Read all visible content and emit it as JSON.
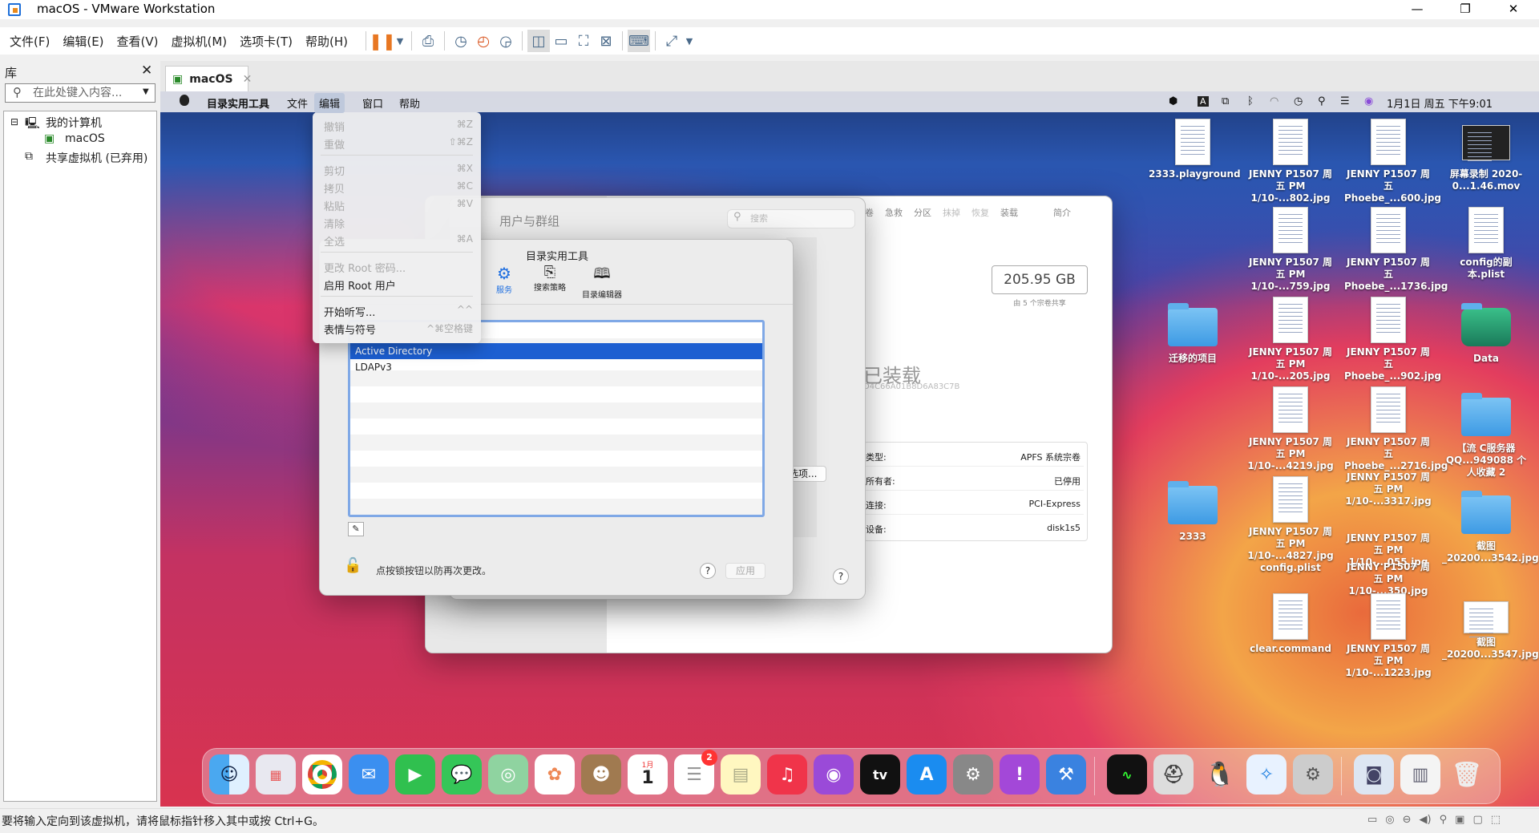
{
  "window": {
    "title": "macOS - VMware Workstation",
    "controls": [
      "—",
      "❐",
      "✕"
    ]
  },
  "menubar": {
    "items": [
      "文件(F)",
      "编辑(E)",
      "查看(V)",
      "虚拟机(M)",
      "选项卡(T)",
      "帮助(H)"
    ]
  },
  "library": {
    "title": "库",
    "close": "✕",
    "search_placeholder": "在此处键入内容...",
    "my_computer": "我的计算机",
    "vm_name": "macOS",
    "shared": "共享虚拟机 (已弃用)"
  },
  "tab": {
    "label": "macOS",
    "close": "✕"
  },
  "mac_menubar": {
    "apple": "",
    "app": "目录实用工具",
    "items": [
      "文件",
      "编辑",
      "窗口",
      "帮助"
    ],
    "clock": "1月1日 周五 下午9:01"
  },
  "edit_menu": {
    "items": [
      {
        "label": "撤销",
        "key": "⌘Z",
        "enabled": false
      },
      {
        "label": "重做",
        "key": "⇧⌘Z",
        "enabled": false
      },
      {
        "label": "剪切",
        "key": "⌘X",
        "enabled": false
      },
      {
        "label": "拷贝",
        "key": "⌘C",
        "enabled": false
      },
      {
        "label": "粘贴",
        "key": "⌘V",
        "enabled": false
      },
      {
        "label": "清除",
        "key": "",
        "enabled": false
      },
      {
        "label": "全选",
        "key": "⌘A",
        "enabled": false
      },
      {
        "label": "更改 Root 密码...",
        "key": "",
        "enabled": false
      },
      {
        "label": "启用 Root 用户",
        "key": "",
        "enabled": true
      },
      {
        "label": "开始听写...",
        "key": "^^",
        "enabled": true
      },
      {
        "label": "表情与符号",
        "key": "^⌘空格键",
        "enabled": true
      }
    ]
  },
  "users_groups": {
    "title": "用户与群组",
    "search_placeholder": "搜索",
    "option_button": "选项...",
    "help": "?"
  },
  "disk_utility": {
    "toolbar": [
      "卷",
      "急救",
      "分区",
      "抹掉",
      "恢复",
      "装载",
      "简介"
    ],
    "capacity": "205.95 GB",
    "capacity_note": "由 5 个宗卷共享",
    "mounted": "已装载",
    "uuid": "D4C66A01B8D6A83C7B",
    "rows": [
      {
        "k": "类型:",
        "v": "APFS 系统宗卷"
      },
      {
        "k": "所有者:",
        "v": "已停用"
      },
      {
        "k": "连接:",
        "v": "PCI-Express"
      },
      {
        "k": "设备:",
        "v": "disk1s5"
      }
    ]
  },
  "dir_utility": {
    "title": "目录实用工具",
    "tabs": [
      "服务",
      "搜索策略",
      "目录编辑器"
    ],
    "services": [
      "Active Directory",
      "LDAPv3"
    ],
    "edit_icon": "✎",
    "lock_text": "点按锁按钮以防再次更改。",
    "help": "?",
    "apply": "应用"
  },
  "desktop": {
    "icons": [
      "2333.playground",
      "JENNY P1507 周五 PM 1/10-...802.jpg",
      "JENNY P1507 周五 Phoebe_...600.jpg",
      "屏幕录制 2020-0...1.46.mov",
      "JENNY P1507 周五 PM 1/10-...759.jpg",
      "JENNY P1507 周五 Phoebe_...1736.jpg",
      "config的副本.plist",
      "迁移的项目",
      "JENNY P1507 周五 PM 1/10-...205.jpg",
      "JENNY P1507 周五 Phoebe_...902.jpg",
      "Data",
      "JENNY P1507 周五 PM 1/10-...4219.jpg",
      "JENNY P1507 周五 Phoebe_...2716.jpg",
      "JENNY P1507 周五 PM 1/10-...3317.jpg",
      "【流 C服务器 QQ...949088 个人收藏 2",
      "2333",
      "JENNY P1507 周五 PM 1/10-...4827.jpg",
      "config.plist",
      "JENNY P1507 周五 PM 1/10-...055.jpg",
      "JENNY P1507 周五 PM 1/10-...350.jpg",
      "截图 _20200...3542.jpg",
      "clear.command",
      "JENNY P1507 周五 PM 1/10-...1223.jpg",
      "截图 _20200...3547.jpg"
    ]
  },
  "dock": {
    "calendar_month": "1月",
    "calendar_day": "1",
    "reminders_badge": "2",
    "tv": "tv"
  },
  "status": {
    "message": "要将输入定向到该虚拟机，请将鼠标指针移入其中或按 Ctrl+G。"
  }
}
